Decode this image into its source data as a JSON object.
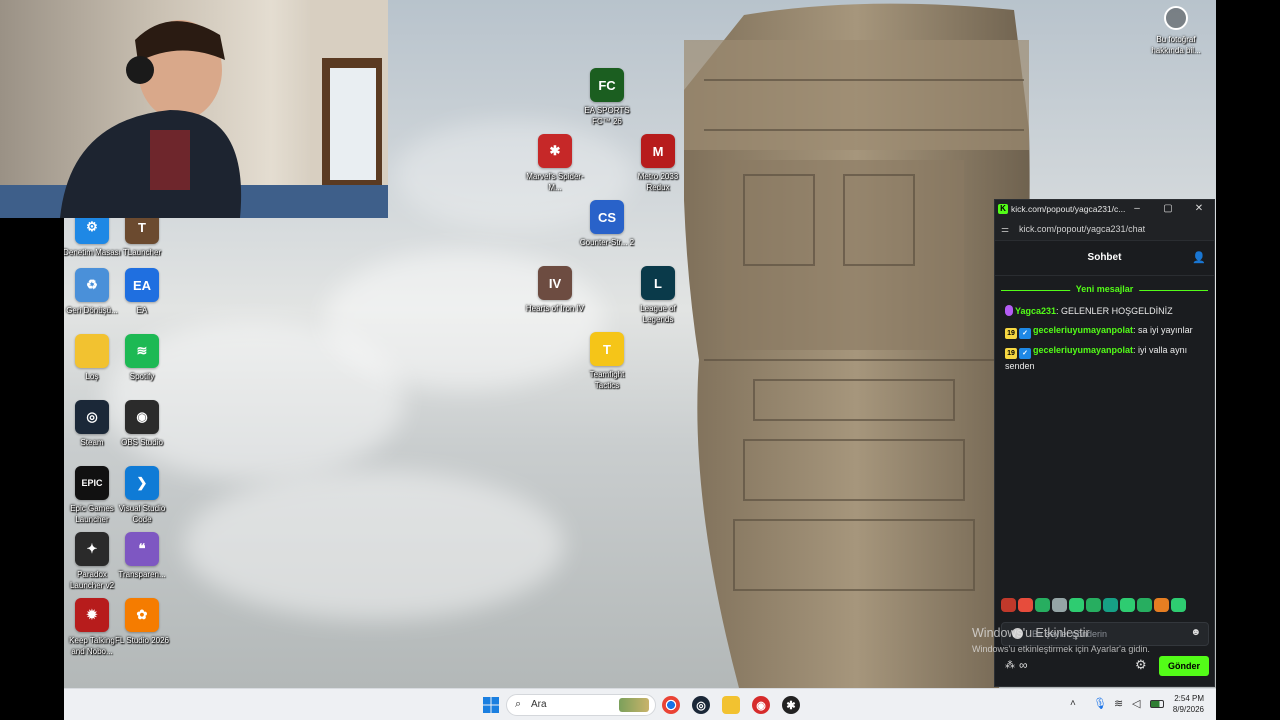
{
  "desktop_icons": [
    {
      "label": "Denetim Masası",
      "color": "#1e88e5",
      "glyph": "⚙"
    },
    {
      "label": "TLauncher",
      "color": "#6b4a2f",
      "glyph": "T"
    },
    {
      "label": "Geri Dönüşü...",
      "color": "#4a90d9",
      "glyph": "♻"
    },
    {
      "label": "EA",
      "color": "#1f6fe0",
      "glyph": "EA"
    },
    {
      "label": "Loş",
      "color": "#f2c230",
      "glyph": ""
    },
    {
      "label": "Spotify",
      "color": "#1db954",
      "glyph": "≋"
    },
    {
      "label": "Steam",
      "color": "#1b2838",
      "glyph": "◎"
    },
    {
      "label": "OBS Studio",
      "color": "#2b2b2b",
      "glyph": "◉"
    },
    {
      "label": "Epic Games Launcher",
      "color": "#111",
      "glyph": "EPIC"
    },
    {
      "label": "Visual Studio Code",
      "color": "#0f7bd6",
      "glyph": "❯"
    },
    {
      "label": "Paradox Launcher v2",
      "color": "#2a2a2a",
      "glyph": "✦"
    },
    {
      "label": "Transparen...",
      "color": "#7e57c2",
      "glyph": "❝"
    },
    {
      "label": "Keep Talking and Nobo...",
      "color": "#b71c1c",
      "glyph": "✹"
    },
    {
      "label": "FL Studio 2026",
      "color": "#f57c00",
      "glyph": "✿"
    },
    {
      "label": "EA SPORTS FC™ 26",
      "color": "#1b5e20",
      "glyph": "FC"
    },
    {
      "label": "Marvel's Spider-M...",
      "color": "#c62828",
      "glyph": "✱"
    },
    {
      "label": "Metro 2033 Redux",
      "color": "#b71c1c",
      "glyph": "M"
    },
    {
      "label": "Counter-Str... 2",
      "color": "#2962c9",
      "glyph": "CS"
    },
    {
      "label": "Hearts of Iron IV",
      "color": "#6d4c41",
      "glyph": "IV"
    },
    {
      "label": "League of Legends",
      "color": "#0a3a4a",
      "glyph": "L"
    },
    {
      "label": "Teamfight Tactics",
      "color": "#f5c518",
      "glyph": "T"
    }
  ],
  "desktop_top_right": {
    "label": "Bu fotoğraf hakkında bil..."
  },
  "chat_window": {
    "title": "kick.com/popout/yagca231/c...",
    "url": "kick.com/popout/yagca231/chat",
    "header": "Sohbet",
    "new_messages_divider": "Yeni mesajlar",
    "messages": [
      {
        "user": "Yagca231",
        "text": ": GELENLER HOŞGELDİNİZ",
        "user_color": "#53fc18",
        "badge": "mic",
        "badge_text": ""
      },
      {
        "user": "geceleriuyumayanpolat",
        "text": ": sa iyi yayınlar",
        "user_color": "#53fc18",
        "badge": "sub",
        "badge_text": "19"
      },
      {
        "user": "geceleriuyumayanpolat",
        "text": ": iyi valla aynı senden",
        "user_color": "#53fc18",
        "badge": "sub",
        "badge_text": "19"
      }
    ],
    "input_placeholder": "Bir şeyler gönderin",
    "send_label": "Gönder",
    "emote_colors": [
      "#c0392b",
      "#e74c3c",
      "#27ae60",
      "#95a5a6",
      "#2ecc71",
      "#27ae60",
      "#16a085",
      "#2ecc71",
      "#27ae60",
      "#e67e22",
      "#2ecc71"
    ]
  },
  "watermark": {
    "line1": "Windows'u Etkinleştir",
    "line2": "Windows'u etkinleştirmek için Ayarlar'a gidin."
  },
  "taskbar": {
    "search_placeholder": "Ara",
    "time": "2:54 PM",
    "date": "8/9/2026"
  }
}
